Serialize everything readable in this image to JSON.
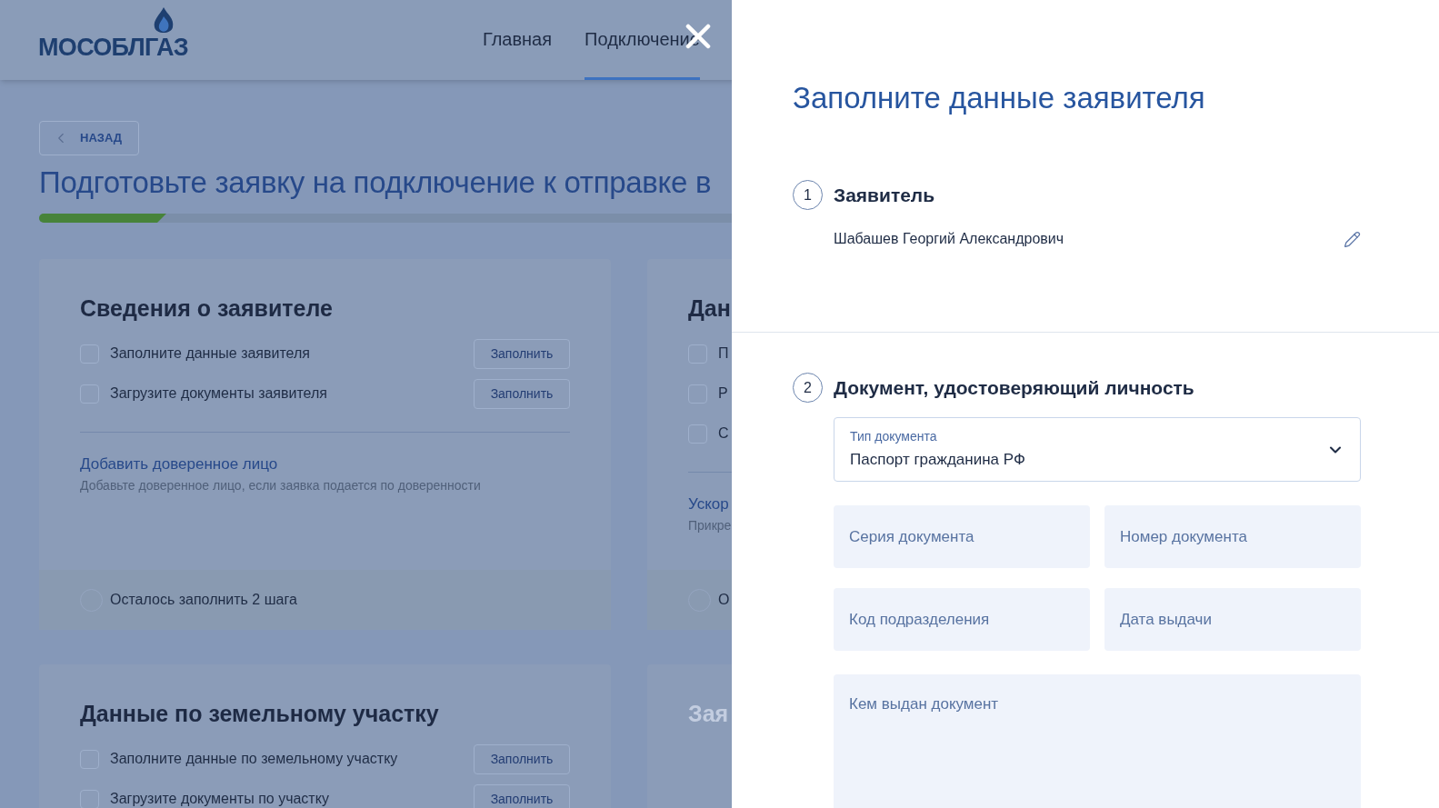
{
  "header": {
    "logo_text": "МОСОБЛГАЗ",
    "nav": [
      {
        "label": "Главная",
        "selected": false
      },
      {
        "label": "Подключение",
        "selected": true
      }
    ]
  },
  "back_button": "НАЗАД",
  "page_title": "Подготовьте заявку на подключение к отправке в",
  "progress": {
    "level": 0.1
  },
  "cards": [
    {
      "title": "Сведения о заявителе",
      "faded": false,
      "tasks": [
        {
          "label": "Заполните данные заявителя",
          "checked": false,
          "button": "Заполнить"
        },
        {
          "label": "Загрузите документы заявителя",
          "checked": false,
          "button": "Заполнить"
        }
      ],
      "link": {
        "title": "Добавить доверенное лицо",
        "hint": "Добавьте доверенное лицо, если заявка подается по доверенности"
      },
      "footer": "Осталось заполнить 2 шага"
    },
    {
      "title": "Дан",
      "faded": false,
      "tasks": [
        {
          "label": "П",
          "checked": false
        },
        {
          "label": "Р",
          "checked": false
        },
        {
          "label": "С",
          "checked": false
        }
      ],
      "link": {
        "title": "Ускор",
        "hint": "Прикре"
      },
      "footer": "О"
    },
    {
      "title": "Данные по земельному участку",
      "faded": false,
      "tasks": [
        {
          "label": "Заполните данные по земельному участку",
          "checked": false,
          "button": "Заполнить"
        },
        {
          "label": "Загрузите документы по участку",
          "checked": false,
          "button": "Заполнить"
        }
      ]
    },
    {
      "title": "Зая",
      "faded": true
    }
  ],
  "drawer": {
    "title": "Заполните данные заявителя",
    "steps": [
      {
        "number": "1",
        "title": "Заявитель",
        "value": "Шабашев Георгий Александрович"
      },
      {
        "number": "2",
        "title": "Документ, удостоверяющий личность",
        "select": {
          "label": "Тип документа",
          "value": "Паспорт гражданина РФ"
        },
        "fields": [
          {
            "placeholder": "Серия документа"
          },
          {
            "placeholder": "Номер документа"
          },
          {
            "placeholder": "Код подразделения"
          },
          {
            "placeholder": "Дата выдачи"
          }
        ],
        "textarea": {
          "placeholder": "Кем выдан документ"
        }
      }
    ]
  }
}
